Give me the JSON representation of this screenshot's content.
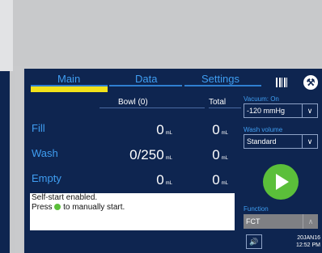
{
  "tabs": [
    {
      "label": "Main",
      "active": true
    },
    {
      "label": "Data",
      "active": false
    },
    {
      "label": "Settings",
      "active": false
    }
  ],
  "table": {
    "headers": {
      "bowl": "Bowl (0)",
      "total": "Total"
    },
    "unit": "mL",
    "rows": [
      {
        "label": "Fill",
        "bowl": "0",
        "total": "0"
      },
      {
        "label": "Wash",
        "bowl": "0/250",
        "total": "0"
      },
      {
        "label": "Empty",
        "bowl": "0",
        "total": "0"
      }
    ]
  },
  "message": {
    "line1": "Self-start enabled.",
    "line2_prefix": "Press",
    "line2_suffix": "to manually start."
  },
  "vacuum": {
    "label": "Vacuum: On",
    "value": "-120 mmHg"
  },
  "wash_volume": {
    "label": "Wash volume",
    "value": "Standard"
  },
  "function": {
    "label": "Function",
    "value": "FCT"
  },
  "datetime": {
    "date": "20JAN16",
    "time": "12:52 PM"
  },
  "colors": {
    "accent": "#3f9ef2",
    "panel": "#0e2550",
    "active_tab": "#f2e21a",
    "start": "#5bbf3a"
  },
  "icons": [
    "barcode-icon",
    "wrench-icon",
    "play-icon",
    "speaker-icon",
    "chevron-down-icon",
    "chevron-up-icon"
  ]
}
